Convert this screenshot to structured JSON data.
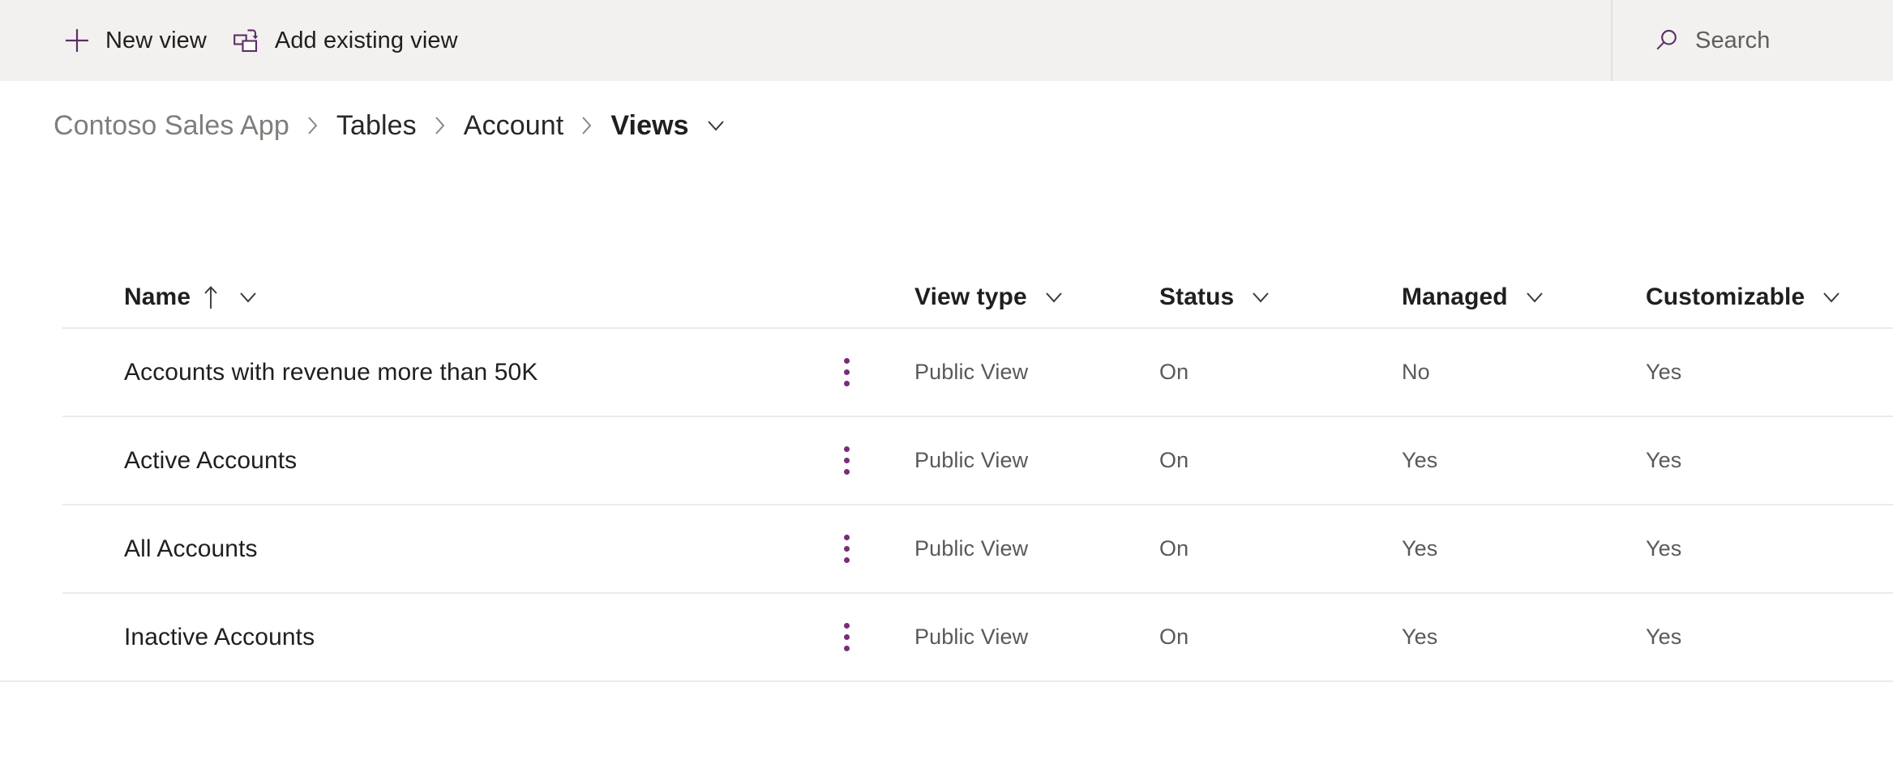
{
  "theme": {
    "accent_purple": "#742774",
    "commandbar_bg": "#f2f1f0",
    "page_bg": "#ffffff",
    "row_divider": "#edebe9",
    "text_primary": "#201f1e",
    "text_secondary": "#5b5957",
    "text_muted": "#807d7a"
  },
  "commandbar": {
    "new_view": {
      "label": "New view",
      "icon": "plus-icon"
    },
    "add_existing_view": {
      "label": "Add existing view",
      "icon": "add-existing-view-icon"
    },
    "search": {
      "placeholder": "Search",
      "value": "",
      "icon": "search-icon"
    }
  },
  "breadcrumb": {
    "items": [
      {
        "label": "Contoso Sales App",
        "style": "muted"
      },
      {
        "label": "Tables",
        "style": "normal"
      },
      {
        "label": "Account",
        "style": "normal"
      },
      {
        "label": "Views",
        "style": "current"
      }
    ],
    "separator": "›",
    "trailing_chevron": "chevron-down-icon"
  },
  "grid": {
    "columns": [
      {
        "key": "name",
        "label": "Name",
        "sorted": true,
        "sort_direction": "ascending",
        "sort_glyph": "↑",
        "menu_icon": "chevron-down-icon"
      },
      {
        "key": "view_type",
        "label": "View type",
        "sorted": false,
        "menu_icon": "chevron-down-icon"
      },
      {
        "key": "status",
        "label": "Status",
        "sorted": false,
        "menu_icon": "chevron-down-icon"
      },
      {
        "key": "managed",
        "label": "Managed",
        "sorted": false,
        "menu_icon": "chevron-down-icon"
      },
      {
        "key": "customizable",
        "label": "Customizable",
        "sorted": false,
        "menu_icon": "chevron-down-icon"
      }
    ],
    "row_menu_icon": "more-vertical-icon",
    "rows": [
      {
        "name": "Accounts with revenue more than 50K",
        "view_type": "Public View",
        "status": "On",
        "managed": "No",
        "customizable": "Yes"
      },
      {
        "name": "Active Accounts",
        "view_type": "Public View",
        "status": "On",
        "managed": "Yes",
        "customizable": "Yes"
      },
      {
        "name": "All Accounts",
        "view_type": "Public View",
        "status": "On",
        "managed": "Yes",
        "customizable": "Yes"
      },
      {
        "name": "Inactive Accounts",
        "view_type": "Public View",
        "status": "On",
        "managed": "Yes",
        "customizable": "Yes"
      }
    ]
  }
}
